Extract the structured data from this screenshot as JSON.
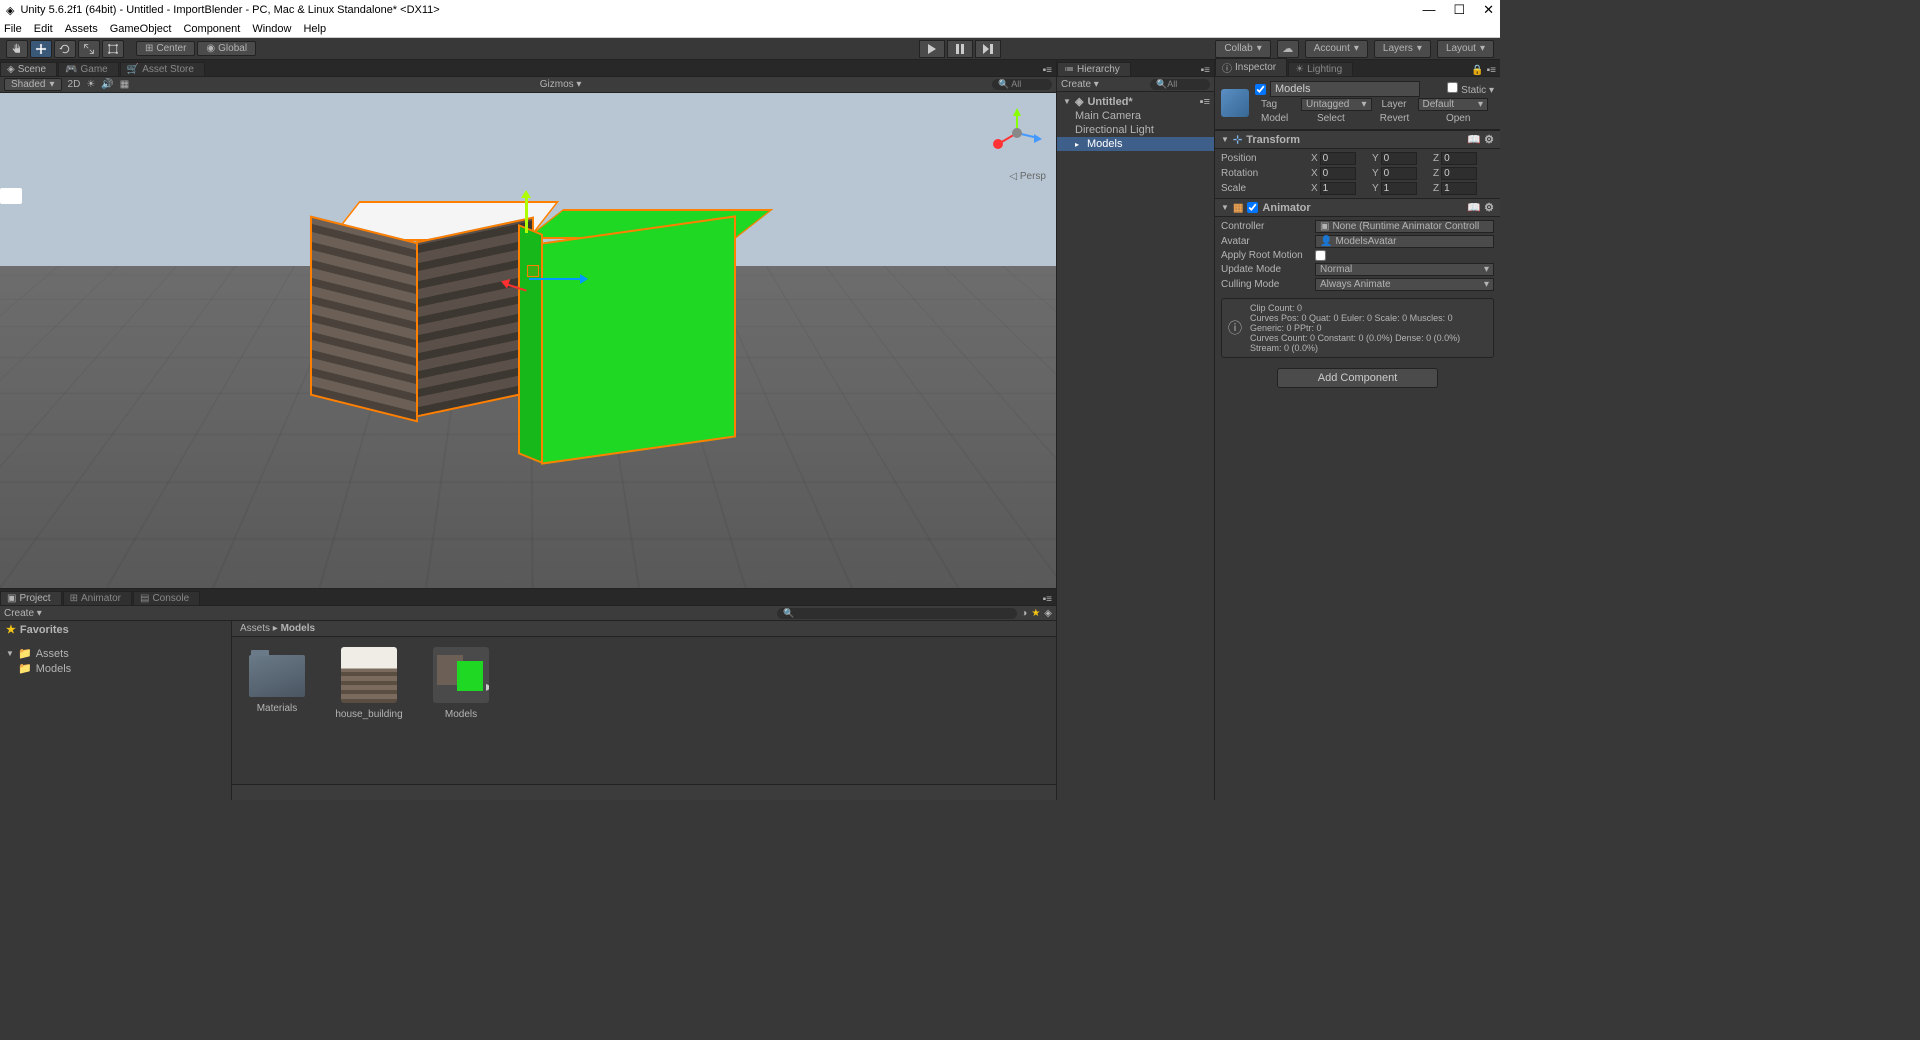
{
  "window": {
    "title": "Unity 5.6.2f1 (64bit) - Untitled - ImportBlender - PC, Mac & Linux Standalone* <DX11>"
  },
  "menubar": [
    "File",
    "Edit",
    "Assets",
    "GameObject",
    "Component",
    "Window",
    "Help"
  ],
  "toolbar": {
    "pivot_center": "Center",
    "pivot_global": "Global",
    "collab": "Collab",
    "account": "Account",
    "layers": "Layers",
    "layout": "Layout"
  },
  "scene_tabs": {
    "scene": "Scene",
    "game": "Game",
    "asset_store": "Asset Store"
  },
  "scene_toolbar": {
    "shaded": "Shaded",
    "twod": "2D",
    "gizmos": "Gizmos",
    "all": "All",
    "persp": "Persp"
  },
  "hierarchy": {
    "title": "Hierarchy",
    "create": "Create",
    "search_all": "All",
    "scene_name": "Untitled*",
    "items": [
      "Main Camera",
      "Directional Light",
      "Models"
    ]
  },
  "inspector": {
    "tabs": {
      "inspector": "Inspector",
      "lighting": "Lighting"
    },
    "object_name": "Models",
    "static": "Static",
    "tag_label": "Tag",
    "tag_value": "Untagged",
    "layer_label": "Layer",
    "layer_value": "Default",
    "model_label": "Model",
    "select": "Select",
    "revert": "Revert",
    "open": "Open",
    "transform": {
      "title": "Transform",
      "position": "Position",
      "rotation": "Rotation",
      "scale": "Scale",
      "px": "0",
      "py": "0",
      "pz": "0",
      "rx": "0",
      "ry": "0",
      "rz": "0",
      "sx": "1",
      "sy": "1",
      "sz": "1"
    },
    "animator": {
      "title": "Animator",
      "controller": "Controller",
      "controller_val": "None (Runtime Animator Controll",
      "avatar": "Avatar",
      "avatar_val": "ModelsAvatar",
      "apply_root": "Apply Root Motion",
      "update_mode": "Update Mode",
      "update_mode_val": "Normal",
      "culling_mode": "Culling Mode",
      "culling_mode_val": "Always Animate",
      "info": "Clip Count: 0\nCurves Pos: 0 Quat: 0 Euler: 0 Scale: 0 Muscles: 0 Generic: 0 PPtr: 0\nCurves Count: 0 Constant: 0 (0.0%) Dense: 0 (0.0%) Stream: 0 (0.0%)"
    },
    "add_component": "Add Component"
  },
  "project": {
    "tabs": {
      "project": "Project",
      "animator": "Animator",
      "console": "Console"
    },
    "create": "Create",
    "favorites": "Favorites",
    "assets": "Assets",
    "models_folder": "Models",
    "breadcrumb_assets": "Assets",
    "breadcrumb_models": "Models",
    "items": [
      {
        "label": "Materials"
      },
      {
        "label": "house_building"
      },
      {
        "label": "Models"
      }
    ]
  }
}
